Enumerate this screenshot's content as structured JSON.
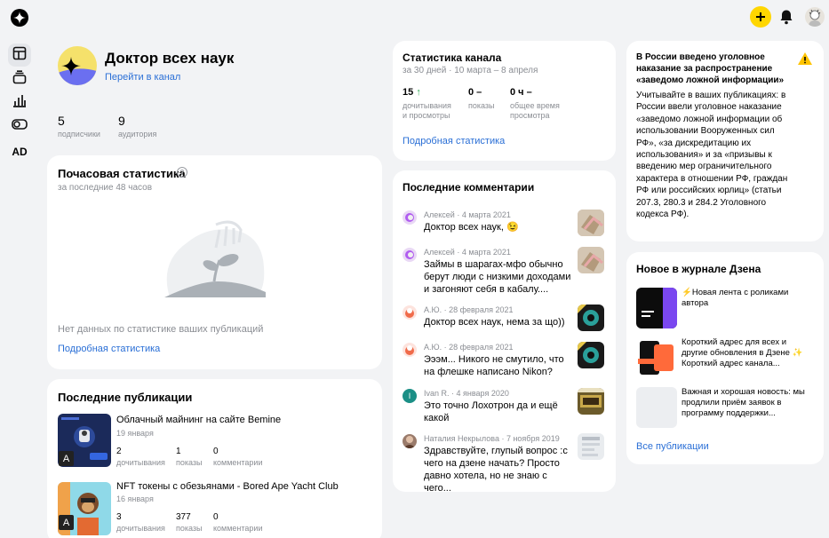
{
  "channel": {
    "name": "Доктор всех наук",
    "goto_link": "Перейти в канал",
    "subscribers_value": "5",
    "subscribers_label": "подписчики",
    "audience_value": "9",
    "audience_label": "аудитория"
  },
  "hourly": {
    "title": "Почасовая статистика",
    "subtitle": "за последние 48 часов",
    "empty_text": "Нет данных по статистике ваших публикаций",
    "link": "Подробная статистика"
  },
  "recent_pubs": {
    "title": "Последние публикации",
    "items": [
      {
        "title": "Облачный майнинг на сайте Bemine",
        "date": "19 января",
        "reads": "2",
        "reads_label": "дочитывания",
        "views": "1",
        "views_label": "показы",
        "comments": "0",
        "comments_label": "комментарии"
      },
      {
        "title": "NFT токены с обезьянами - Bored Ape Yacht Club",
        "date": "16 января",
        "reads": "3",
        "reads_label": "дочитывания",
        "views": "377",
        "views_label": "показы",
        "comments": "0",
        "comments_label": "комментарии"
      }
    ]
  },
  "channel_stats": {
    "title": "Статистика канала",
    "subtitle": "за 30 дней · 10 марта – 8 апреля",
    "reads_value": "15",
    "reads_label1": "дочитывания",
    "reads_label2": "и просмотры",
    "views_value": "0 –",
    "views_label": "показы",
    "time_value": "0 ч –",
    "time_label1": "общее время",
    "time_label2": "просмотра",
    "link": "Подробная статистика"
  },
  "comments": {
    "title": "Последние комментарии",
    "items": [
      {
        "author": "Алексей",
        "date": "4 марта 2021",
        "text": "Доктор всех наук, 😉"
      },
      {
        "author": "Алексей",
        "date": "4 марта 2021",
        "text": "Займы в шарагах-мфо обычно берут люди с низкими доходами и загоняют себя в кабалу...."
      },
      {
        "author": "А.Ю.",
        "date": "28 февраля 2021",
        "text": "Доктор всех наук, нема за що))"
      },
      {
        "author": "А.Ю.",
        "date": "28 февраля 2021",
        "text": "Эээм... Никого не смутило, что на флешке написано Nikon?"
      },
      {
        "author": "Ivan R.",
        "date": "4 января 2020",
        "text": "Это точно Лохотрон да и ещё какой"
      },
      {
        "author": "Наталия Некрылова",
        "date": "7 ноября 2019",
        "text": "Здравствуйте, глупый вопрос :с чего на дзене начать? Просто давно хотела, но не знаю с чего..."
      }
    ]
  },
  "notice": {
    "title": "В России введено уголовное наказание за распространение «заведомо ложной информации»",
    "body": "Учитывайте в ваших публикациях: в России ввели уголовное наказание «заведомо ложной информации об использовании Вооруженных сил РФ», «за дискредитацию их использования» и за «призывы к введению мер ограничительного характера в отношении РФ, граждан РФ или российских юрлиц» (статьи 207.3, 280.3 и 284.2 Уголовного кодекса РФ)."
  },
  "journal": {
    "title": "Новое в журнале Дзена",
    "items": [
      {
        "text": "⚡Новая лента с роликами автора"
      },
      {
        "text": "Короткий адрес для всех и другие обновления в Дзене ✨ Короткий адрес канала..."
      },
      {
        "text": "Важная и хорошая новость: мы продлили приём заявок в программу поддержки..."
      }
    ],
    "all_link": "Все публикации"
  },
  "sidebar": {
    "ad_label": "AD"
  },
  "colors": {
    "accent_yellow": "#ffd600",
    "link_blue": "#2a6fd6",
    "background": "#f2f3f5",
    "up_arrow": "#2aa84f"
  }
}
